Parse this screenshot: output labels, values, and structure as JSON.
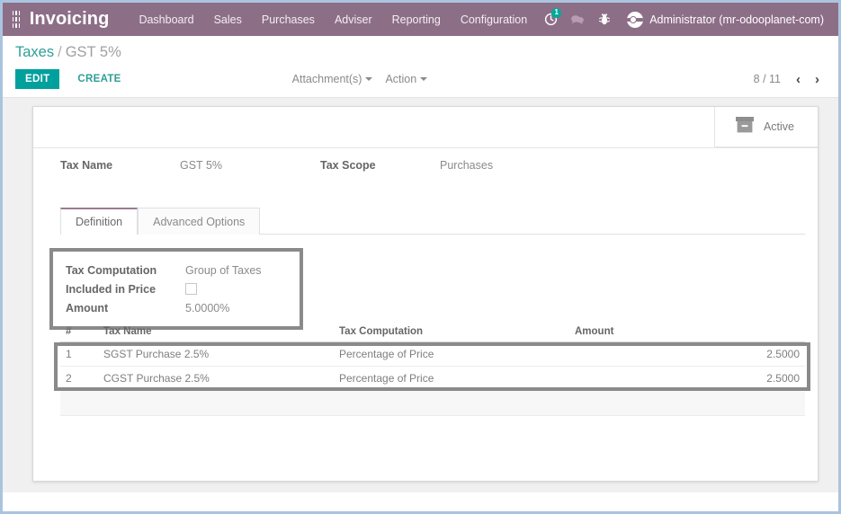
{
  "navbar": {
    "apps_icon": "apps-grid-icon",
    "brand": "Invoicing",
    "menu": [
      {
        "label": "Dashboard"
      },
      {
        "label": "Sales"
      },
      {
        "label": "Purchases"
      },
      {
        "label": "Adviser"
      },
      {
        "label": "Reporting"
      },
      {
        "label": "Configuration"
      }
    ],
    "icons": [
      {
        "name": "activity-clock-icon",
        "badge": "1"
      },
      {
        "name": "chat-bubble-icon",
        "badge": ""
      },
      {
        "name": "bug-icon",
        "badge": ""
      }
    ],
    "user": "Administrator (mr-odooplanet-com)",
    "brand_color": "#8d6e87",
    "badge_color": "#00a99d"
  },
  "control_panel": {
    "breadcrumb_root": "Taxes",
    "breadcrumb_sep": "/",
    "breadcrumb_current": "GST 5%",
    "edit_label": "EDIT",
    "create_label": "CREATE",
    "attachments_label": "Attachment(s)",
    "action_label": "Action",
    "pager_text": "8 / 11",
    "pager_prev": "‹",
    "pager_next": "›",
    "accent_color": "#00a09d"
  },
  "form": {
    "stat_button": {
      "icon": "archive-box-icon",
      "label": "Active"
    },
    "fields": [
      {
        "label": "Tax Name",
        "value": "GST 5%"
      },
      {
        "label": "Tax Scope",
        "value": "Purchases"
      }
    ],
    "tabs": [
      {
        "label": "Definition",
        "active": true
      },
      {
        "label": "Advanced Options",
        "active": false
      }
    ],
    "definition": {
      "rows": [
        {
          "label": "Tax Computation",
          "value": "Group of Taxes",
          "type": "text"
        },
        {
          "label": "Included in Price",
          "value": "",
          "type": "checkbox",
          "checked": false
        },
        {
          "label": "Amount",
          "value": "5.0000%",
          "type": "text"
        }
      ]
    },
    "table": {
      "columns": [
        {
          "label": "#",
          "key": "seq"
        },
        {
          "label": "Tax Name",
          "key": "name"
        },
        {
          "label": "Tax Computation",
          "key": "computation"
        },
        {
          "label": "Amount",
          "key": "amount"
        }
      ],
      "rows": [
        {
          "seq": "1",
          "name": "SGST Purchase 2.5%",
          "computation": "Percentage of Price",
          "amount": "2.5000"
        },
        {
          "seq": "2",
          "name": "CGST Purchase 2.5%",
          "computation": "Percentage of Price",
          "amount": "2.5000"
        }
      ]
    }
  }
}
